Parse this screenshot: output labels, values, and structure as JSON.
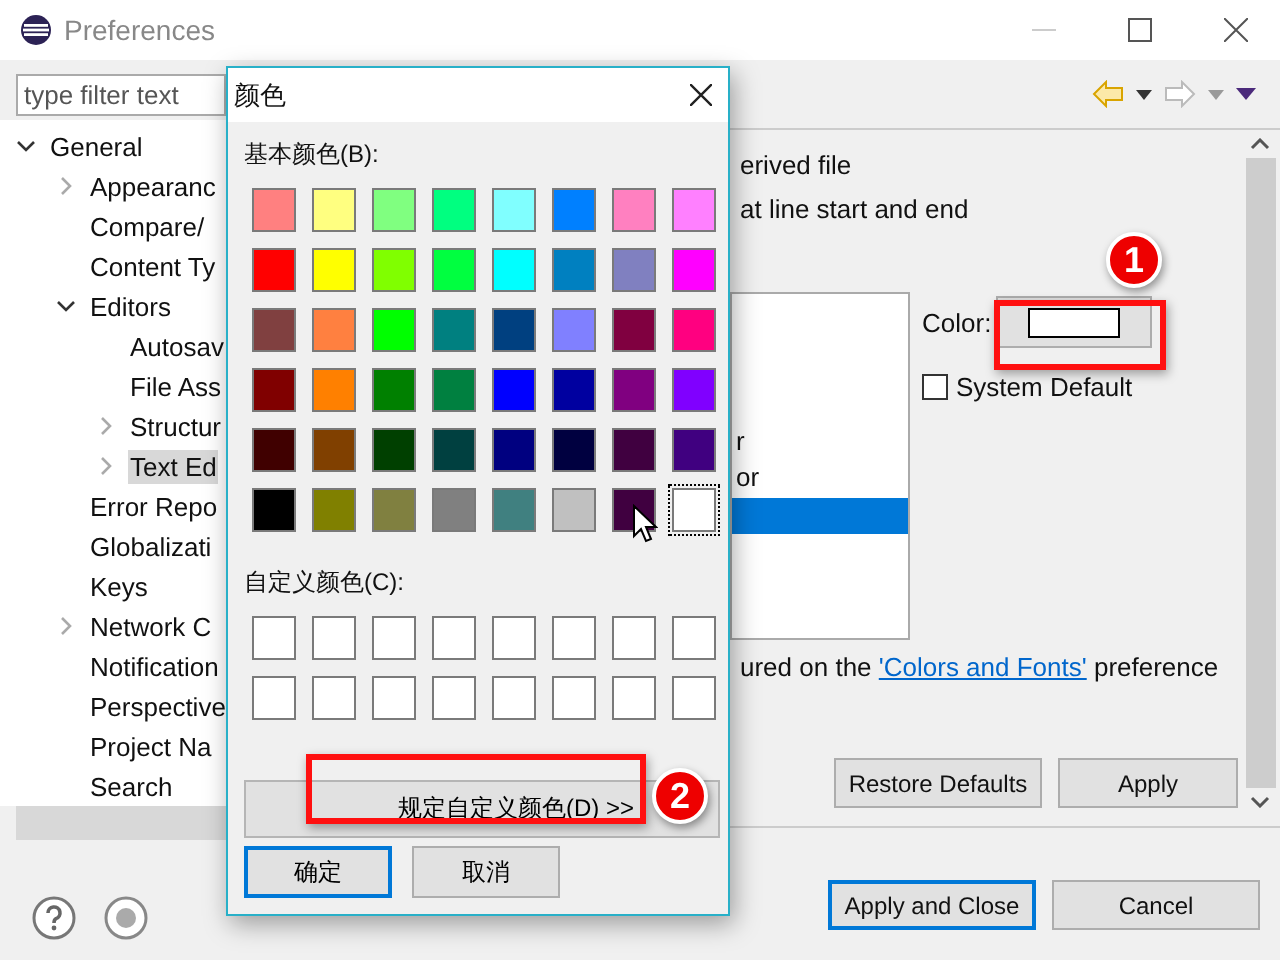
{
  "window": {
    "title": "Preferences"
  },
  "filter": {
    "placeholder": "type filter text"
  },
  "tree": [
    {
      "label": "General",
      "expanded": true,
      "selected": false,
      "children": [
        {
          "label": "Appearanc",
          "expanded": false,
          "selected": false
        },
        {
          "label": "Compare/",
          "selected": false
        },
        {
          "label": "Content Ty",
          "selected": false
        },
        {
          "label": "Editors",
          "expanded": true,
          "selected": false,
          "children": [
            {
              "label": "Autosav",
              "selected": false
            },
            {
              "label": "File Ass",
              "selected": false
            },
            {
              "label": "Structur",
              "expanded": false,
              "selected": false
            },
            {
              "label": "Text Ed",
              "expanded": false,
              "selected": true
            }
          ]
        },
        {
          "label": "Error Repo",
          "selected": false
        },
        {
          "label": "Globalizati",
          "selected": false
        },
        {
          "label": "Keys",
          "selected": false
        },
        {
          "label": "Network C",
          "expanded": false,
          "selected": false
        },
        {
          "label": "Notification",
          "selected": false
        },
        {
          "label": "Perspective",
          "selected": false
        },
        {
          "label": "Project Na",
          "selected": false
        },
        {
          "label": "Search",
          "selected": false
        }
      ]
    }
  ],
  "content": {
    "line_1": "erived file",
    "line_2": "at line start and end",
    "list_items": [
      {
        "label": "r",
        "selected": false
      },
      {
        "label": "or",
        "selected": false
      },
      {
        "selected": true
      }
    ],
    "color_label": "Color:",
    "color_button": {
      "color": "#ffffff"
    },
    "system_default": {
      "label": "System Default",
      "checked": false
    },
    "note_prefix": "ured on the ",
    "note_link": "'Colors and Fonts'",
    "note_suffix": " preference",
    "buttons": [
      "Restore Defaults",
      "Apply"
    ]
  },
  "footer_buttons": [
    {
      "label": "Apply and Close",
      "default": true
    },
    {
      "label": "Cancel",
      "default": false
    }
  ],
  "dialog": {
    "title": "颜色",
    "basic_label": "基本颜色(B):",
    "custom_label": "自定义颜色(C):",
    "basic_colors": [
      {
        "color": "#ff8080",
        "selected": false
      },
      {
        "color": "#ffff80",
        "selected": false
      },
      {
        "color": "#80ff80",
        "selected": false
      },
      {
        "color": "#00ff80",
        "selected": false
      },
      {
        "color": "#80ffff",
        "selected": false
      },
      {
        "color": "#0080ff",
        "selected": false
      },
      {
        "color": "#ff80c0",
        "selected": false
      },
      {
        "color": "#ff80ff",
        "selected": false
      },
      {
        "color": "#ff0000",
        "selected": false
      },
      {
        "color": "#ffff00",
        "selected": false
      },
      {
        "color": "#80ff00",
        "selected": false
      },
      {
        "color": "#00ff40",
        "selected": false
      },
      {
        "color": "#00ffff",
        "selected": false
      },
      {
        "color": "#0080c0",
        "selected": false
      },
      {
        "color": "#8080c0",
        "selected": false
      },
      {
        "color": "#ff00ff",
        "selected": false
      },
      {
        "color": "#804040",
        "selected": false
      },
      {
        "color": "#ff8040",
        "selected": false
      },
      {
        "color": "#00ff00",
        "selected": false
      },
      {
        "color": "#008080",
        "selected": false
      },
      {
        "color": "#004080",
        "selected": false
      },
      {
        "color": "#8080ff",
        "selected": false
      },
      {
        "color": "#800040",
        "selected": false
      },
      {
        "color": "#ff0080",
        "selected": false
      },
      {
        "color": "#800000",
        "selected": false
      },
      {
        "color": "#ff8000",
        "selected": false
      },
      {
        "color": "#008000",
        "selected": false
      },
      {
        "color": "#008040",
        "selected": false
      },
      {
        "color": "#0000ff",
        "selected": false
      },
      {
        "color": "#0000a0",
        "selected": false
      },
      {
        "color": "#800080",
        "selected": false
      },
      {
        "color": "#8000ff",
        "selected": false
      },
      {
        "color": "#400000",
        "selected": false
      },
      {
        "color": "#804000",
        "selected": false
      },
      {
        "color": "#004000",
        "selected": false
      },
      {
        "color": "#004040",
        "selected": false
      },
      {
        "color": "#000080",
        "selected": false
      },
      {
        "color": "#000040",
        "selected": false
      },
      {
        "color": "#400040",
        "selected": false
      },
      {
        "color": "#400080",
        "selected": false
      },
      {
        "color": "#000000",
        "selected": false
      },
      {
        "color": "#808000",
        "selected": false
      },
      {
        "color": "#808040",
        "selected": false
      },
      {
        "color": "#808080",
        "selected": false
      },
      {
        "color": "#408080",
        "selected": false
      },
      {
        "color": "#c0c0c0",
        "selected": false
      },
      {
        "color": "#400040",
        "selected": false
      },
      {
        "color": "#ffffff",
        "selected": true
      }
    ],
    "custom_colors": [
      {
        "color": "#ffffff"
      },
      {
        "color": "#ffffff"
      },
      {
        "color": "#ffffff"
      },
      {
        "color": "#ffffff"
      },
      {
        "color": "#ffffff"
      },
      {
        "color": "#ffffff"
      },
      {
        "color": "#ffffff"
      },
      {
        "color": "#ffffff"
      },
      {
        "color": "#ffffff"
      },
      {
        "color": "#ffffff"
      },
      {
        "color": "#ffffff"
      },
      {
        "color": "#ffffff"
      },
      {
        "color": "#ffffff"
      },
      {
        "color": "#ffffff"
      },
      {
        "color": "#ffffff"
      },
      {
        "color": "#ffffff"
      }
    ],
    "define_button": "规定自定义颜色(D) >>",
    "ok_button": "确定",
    "cancel_button": "取消"
  },
  "annotations": [
    {
      "number": "1"
    },
    {
      "number": "2"
    }
  ]
}
